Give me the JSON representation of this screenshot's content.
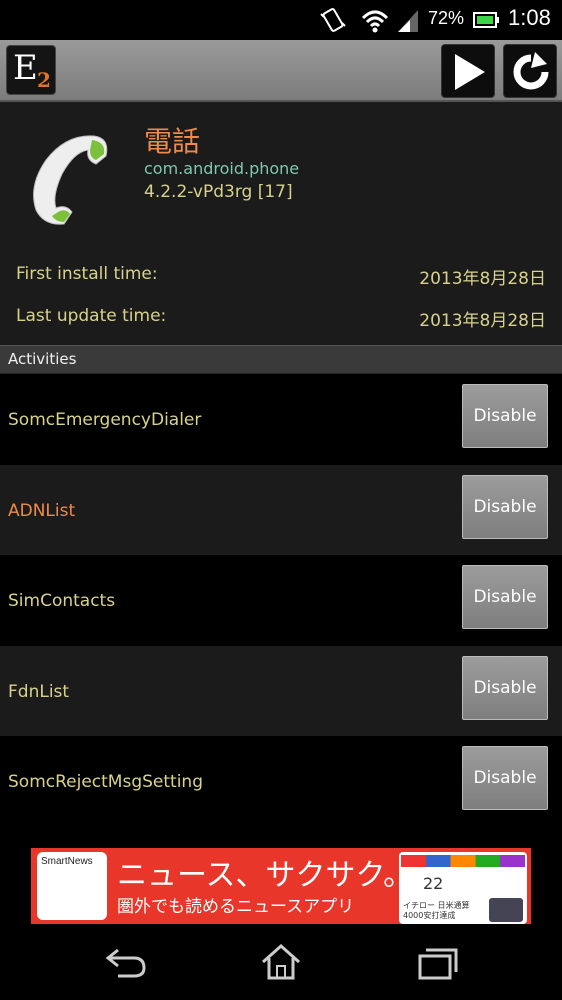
{
  "status_bar": {
    "battery_percent": "72%",
    "time": "1:08",
    "icons": [
      "vibrate-icon",
      "wifi-icon",
      "signal-icon",
      "battery-icon"
    ]
  },
  "toolbar": {
    "logo_letter": "E",
    "logo_subscript": "2",
    "play_icon": "play-icon",
    "refresh_icon": "refresh-icon"
  },
  "app": {
    "name": "電話",
    "package": "com.android.phone",
    "version": "4.2.2-vPd3rg [17]",
    "icon": "phone-handset-icon",
    "first_install_label": "First install time:",
    "first_install_value": "2013年8月28日",
    "last_update_label": "Last update time:",
    "last_update_value": "2013年8月28日"
  },
  "section_title": "Activities",
  "activities": [
    {
      "name": "SomcEmergencyDialer",
      "button": "Disable",
      "highlighted": false
    },
    {
      "name": "ADNList",
      "button": "Disable",
      "highlighted": true
    },
    {
      "name": "SimContacts",
      "button": "Disable",
      "highlighted": false
    },
    {
      "name": "FdnList",
      "button": "Disable",
      "highlighted": false
    },
    {
      "name": "SomcRejectMsgSetting",
      "button": "Disable",
      "highlighted": false
    }
  ],
  "ad": {
    "logo_text": "SmartNews",
    "headline": "ニュース、サクサク。",
    "subline": "圏外でも読めるニュースアプリ",
    "preview_number": "22",
    "preview_news_1": "イチロー 日米通算",
    "preview_news_2": "4000安打達成"
  },
  "colors": {
    "accent_orange": "#f08a4b",
    "text_yellow": "#d8d28c",
    "package_teal": "#7ec7b1"
  }
}
